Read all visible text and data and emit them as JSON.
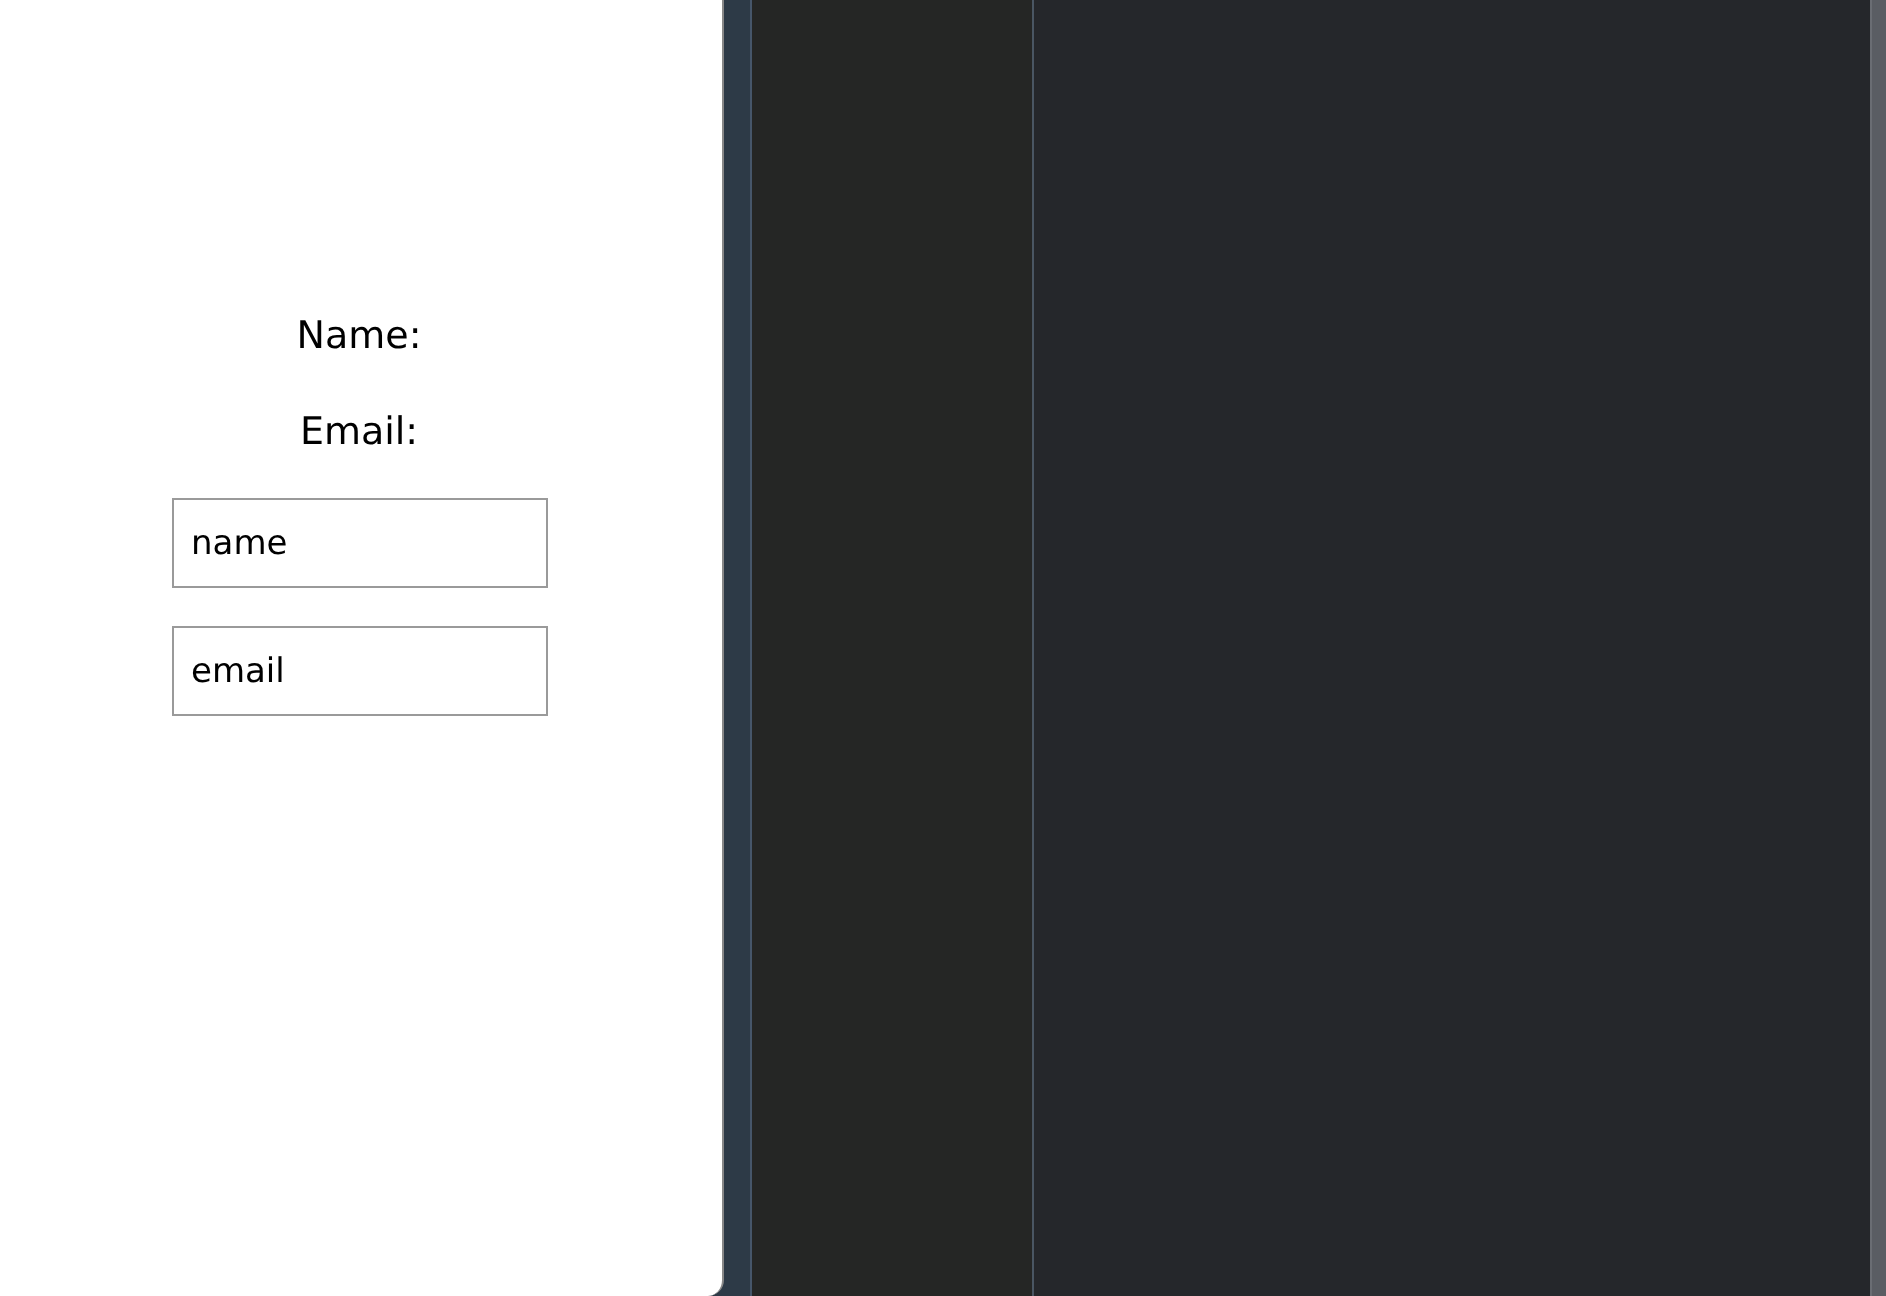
{
  "form": {
    "labels": [
      "Name:",
      "Email:"
    ],
    "fields": [
      {
        "value": "name"
      },
      {
        "value": "email"
      }
    ]
  }
}
